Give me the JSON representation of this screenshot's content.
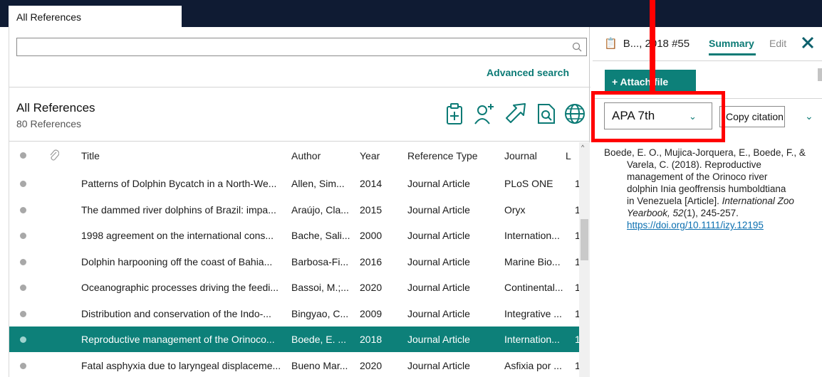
{
  "tabs": [
    {
      "label": "All References"
    }
  ],
  "search": {
    "value": "",
    "advanced_label": "Advanced search"
  },
  "library": {
    "title": "All References",
    "count": "80 References"
  },
  "toolbar": {
    "icons": [
      "clipboard-add-icon",
      "add-person-icon",
      "export-arrow-icon",
      "find-pdf-icon",
      "globe-icon"
    ]
  },
  "table": {
    "columns": [
      "Title",
      "Author",
      "Year",
      "Reference Type",
      "Journal",
      "L"
    ],
    "rows": [
      {
        "title": "Patterns of Dolphin Bycatch in a North-We...",
        "author": "Allen, Sim...",
        "year": "2014",
        "type": "Journal Article",
        "journal": "PLoS ONE",
        "l": "1"
      },
      {
        "title": "The dammed river dolphins of Brazil: impa...",
        "author": "Araújo, Cla...",
        "year": "2015",
        "type": "Journal Article",
        "journal": "Oryx",
        "l": "1"
      },
      {
        "title": "1998 agreement on the international cons...",
        "author": "Bache, Sali...",
        "year": "2000",
        "type": "Journal Article",
        "journal": "Internation...",
        "l": "1"
      },
      {
        "title": "Dolphin harpooning off the coast of Bahia...",
        "author": "Barbosa-Fi...",
        "year": "2016",
        "type": "Journal Article",
        "journal": "Marine Bio...",
        "l": "1"
      },
      {
        "title": "Oceanographic processes driving the feedi...",
        "author": "Bassoi, M.;...",
        "year": "2020",
        "type": "Journal Article",
        "journal": "Continental...",
        "l": "1"
      },
      {
        "title": "Distribution and conservation of the Indo-...",
        "author": "Bingyao, C...",
        "year": "2009",
        "type": "Journal Article",
        "journal": "Integrative ...",
        "l": "1"
      },
      {
        "title": "Reproductive management of the Orinoco...",
        "author": "Boede, E. ...",
        "year": "2018",
        "type": "Journal Article",
        "journal": "Internation...",
        "l": "1",
        "selected": true
      },
      {
        "title": "Fatal asphyxia due to laryngeal displaceme...",
        "author": "Bueno Mar...",
        "year": "2020",
        "type": "Journal Article",
        "journal": "Asfixia por ...",
        "l": "1"
      }
    ]
  },
  "panel": {
    "title": "B..., 2018 #55",
    "tab_summary": "Summary",
    "tab_edit": "Edit",
    "attach_label": "+ Attach file",
    "style_value": "APA 7th",
    "copy_label": "Copy citation",
    "citation": {
      "line1": "Boede, E. O., Mujica-Jorquera, E., Boede, F., &",
      "line2": "Varela, C. (2018). Reproductive",
      "line3": "management of the Orinoco river",
      "line4": "dolphin Inia geoffrensis humboldtiana",
      "line5a": "in Venezuela [Article]. ",
      "line5b": "International Zoo",
      "line6a": "Yearbook, 52",
      "line6b": "(1), 245-257.",
      "doi": "https://doi.org/10.1111/izy.12195"
    }
  },
  "colors": {
    "accent": "#0d8079",
    "topbar": "#0f1b33",
    "highlight": "#ff0000"
  }
}
